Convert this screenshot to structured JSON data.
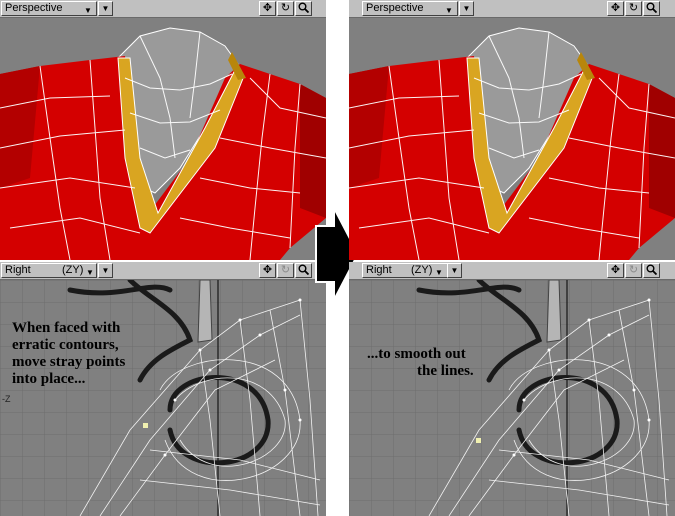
{
  "panels": {
    "left": {
      "top": {
        "view_label": "Perspective",
        "icons": [
          "move-icon",
          "rotate-icon",
          "zoom-icon"
        ]
      },
      "bottom": {
        "view_label": "Right",
        "axis_label": "(ZY)",
        "axis_marker": "-Z",
        "icons": [
          "move-icon",
          "rotate-icon",
          "zoom-icon"
        ],
        "caption_lines": [
          "When faced with",
          "erratic contours,",
          "move stray points",
          "into place..."
        ]
      }
    },
    "right": {
      "top": {
        "view_label": "Perspective",
        "icons": [
          "move-icon",
          "rotate-icon",
          "zoom-icon"
        ]
      },
      "bottom": {
        "view_label": "Right",
        "axis_label": "(ZY)",
        "icons": [
          "move-icon",
          "rotate-icon",
          "zoom-icon"
        ],
        "caption_lines": [
          "...to smooth out",
          "the lines."
        ]
      }
    }
  },
  "transition_arrow": "right-arrow-icon",
  "colors": {
    "shirt_red": "#d40000",
    "collar_gold": "#d9a521",
    "viewport_grey": "#808080",
    "toolbar_grey": "#c0c0c0"
  }
}
